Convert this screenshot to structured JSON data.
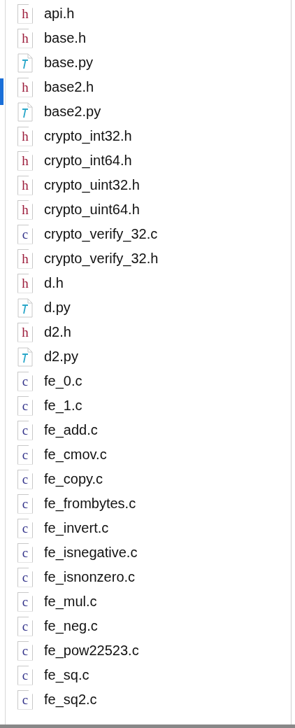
{
  "files": [
    {
      "name": "api.h",
      "kind": "header",
      "badge": "h"
    },
    {
      "name": "base.h",
      "kind": "header",
      "badge": "h"
    },
    {
      "name": "base.py",
      "kind": "python"
    },
    {
      "name": "base2.h",
      "kind": "header",
      "badge": "h"
    },
    {
      "name": "base2.py",
      "kind": "python"
    },
    {
      "name": "crypto_int32.h",
      "kind": "header",
      "badge": "h"
    },
    {
      "name": "crypto_int64.h",
      "kind": "header",
      "badge": "h"
    },
    {
      "name": "crypto_uint32.h",
      "kind": "header",
      "badge": "h"
    },
    {
      "name": "crypto_uint64.h",
      "kind": "header",
      "badge": "h"
    },
    {
      "name": "crypto_verify_32.c",
      "kind": "source",
      "badge": "c"
    },
    {
      "name": "crypto_verify_32.h",
      "kind": "header",
      "badge": "h"
    },
    {
      "name": "d.h",
      "kind": "header",
      "badge": "h"
    },
    {
      "name": "d.py",
      "kind": "python"
    },
    {
      "name": "d2.h",
      "kind": "header",
      "badge": "h"
    },
    {
      "name": "d2.py",
      "kind": "python"
    },
    {
      "name": "fe_0.c",
      "kind": "source",
      "badge": "c"
    },
    {
      "name": "fe_1.c",
      "kind": "source",
      "badge": "c"
    },
    {
      "name": "fe_add.c",
      "kind": "source",
      "badge": "c"
    },
    {
      "name": "fe_cmov.c",
      "kind": "source",
      "badge": "c"
    },
    {
      "name": "fe_copy.c",
      "kind": "source",
      "badge": "c"
    },
    {
      "name": "fe_frombytes.c",
      "kind": "source",
      "badge": "c"
    },
    {
      "name": "fe_invert.c",
      "kind": "source",
      "badge": "c"
    },
    {
      "name": "fe_isnegative.c",
      "kind": "source",
      "badge": "c"
    },
    {
      "name": "fe_isnonzero.c",
      "kind": "source",
      "badge": "c"
    },
    {
      "name": "fe_mul.c",
      "kind": "source",
      "badge": "c"
    },
    {
      "name": "fe_neg.c",
      "kind": "source",
      "badge": "c"
    },
    {
      "name": "fe_pow22523.c",
      "kind": "source",
      "badge": "c"
    },
    {
      "name": "fe_sq.c",
      "kind": "source",
      "badge": "c"
    },
    {
      "name": "fe_sq2.c",
      "kind": "source",
      "badge": "c"
    }
  ]
}
